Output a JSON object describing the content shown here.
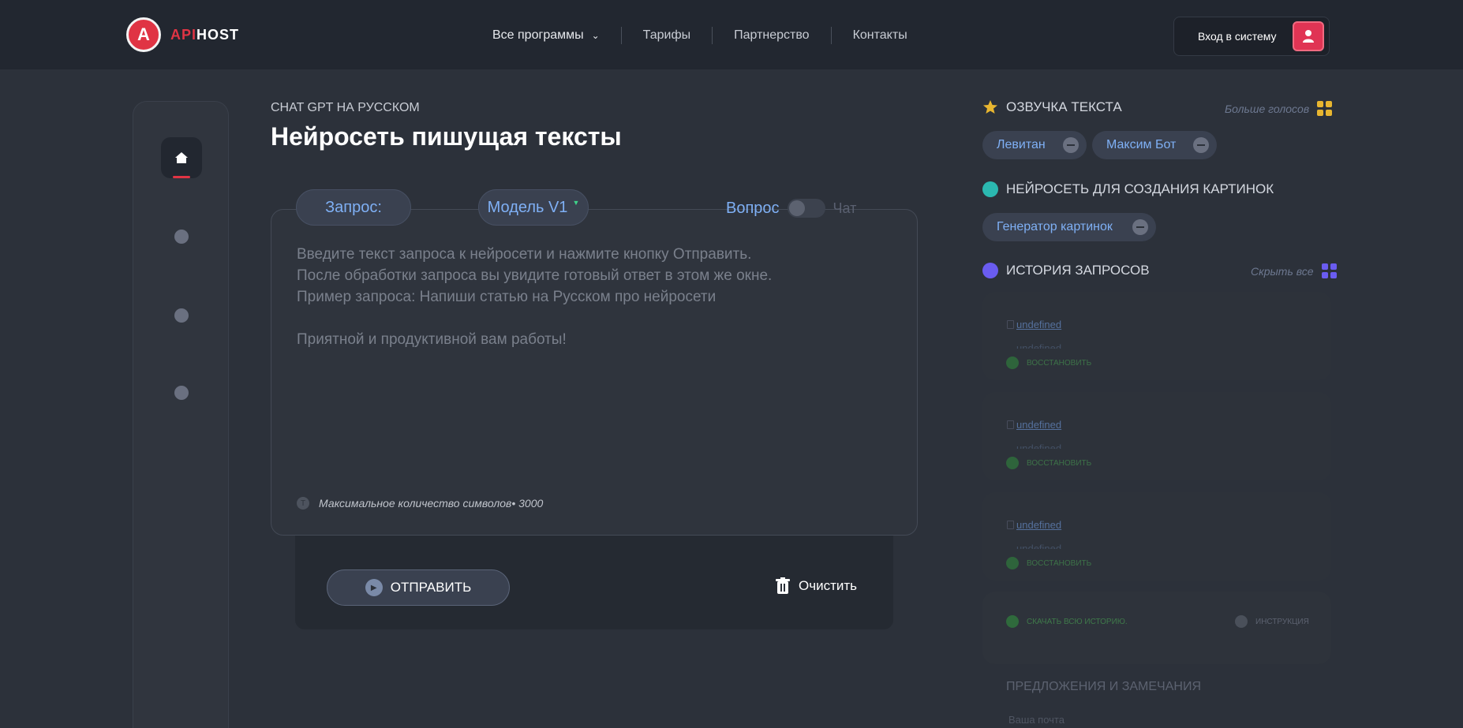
{
  "header": {
    "logo_letter": "A",
    "logo_api": "API",
    "logo_host": "HOST",
    "nav": [
      "Все программы",
      "Тарифы",
      "Партнерство",
      "Контакты"
    ],
    "login_label": "Вход в систему"
  },
  "main": {
    "subtitle": "CHAT GPT НА РУССКОМ",
    "title": "Нейросеть пишущая тексты",
    "query_label": "Запрос:",
    "model_label": "Модель V1",
    "mode_question": "Вопрос",
    "mode_chat": "Чат",
    "placeholder": [
      "Введите текст запроса к нейросети и нажмите кнопку Отправить.",
      "После обработки запроса вы увидите готовый ответ в этом же окне.",
      "Пример запроса: Напиши статью на Русском про нейросети",
      "Приятной и продуктивной вам работы!"
    ],
    "max_chars": "Максимальное количество символов• 3000",
    "send_label": "ОТПРАВИТЬ",
    "clear_label": "Очистить"
  },
  "right": {
    "tts_title": "ОЗВУЧКА ТЕКСТА",
    "more_voices": "Больше голосов",
    "voices": [
      "Левитан",
      "Максим Бот"
    ],
    "images_title": "НЕЙРОСЕТЬ ДЛЯ СОЗДАНИЯ КАРТИНОК",
    "image_tools": [
      "Генератор картинок"
    ],
    "history_title": "ИСТОРИЯ ЗАПРОСОВ",
    "hide_all": "Скрыть все",
    "history": [
      {
        "link": "undefined",
        "link2": "undefined",
        "restore": "ВОССТАНОВИТЬ"
      },
      {
        "link": "undefined",
        "link2": "undefined",
        "restore": "ВОССТАНОВИТЬ"
      },
      {
        "link": "undefined",
        "link2": "undefined",
        "restore": "ВОССТАНОВИТЬ"
      }
    ],
    "download_all": "СКАЧАТЬ ВСЮ ИСТОРИЮ.",
    "instruction": "ИНСТРУКЦИЯ",
    "suggest_title": "ПРЕДЛОЖЕНИЯ И ЗАМЕЧАНИЯ",
    "email_placeholder": "Ваша почта"
  },
  "colors": {
    "accent": "#e03444",
    "link": "#7fb0f5",
    "background": "#2c313a"
  }
}
